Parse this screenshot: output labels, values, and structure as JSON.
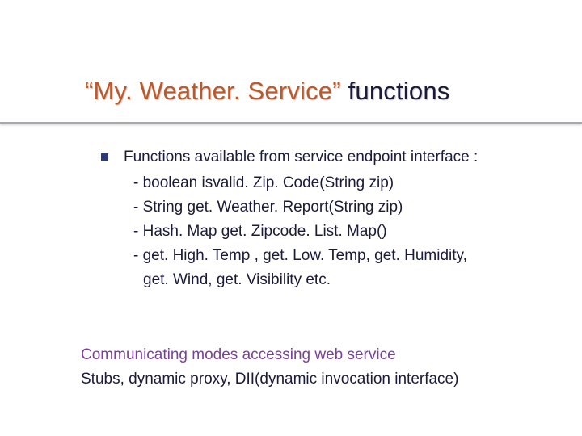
{
  "title": {
    "quoted": "“My. Weather. Service”",
    "rest": " functions"
  },
  "bullet": {
    "lead": "Functions available from service endpoint interface :",
    "items": [
      "- boolean isvalid. Zip. Code(String zip)",
      "- String get. Weather. Report(String zip)",
      "- Hash. Map get. Zipcode. List. Map()",
      "- get. High. Temp , get. Low. Temp, get. Humidity,"
    ],
    "cont": "get. Wind, get. Visibility etc."
  },
  "modes": {
    "heading": "Communicating modes accessing web service",
    "line": "Stubs, dynamic proxy, DII(dynamic invocation interface)"
  }
}
